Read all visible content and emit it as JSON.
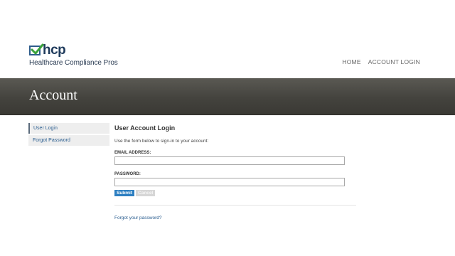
{
  "brand": {
    "logo_text": "hcp",
    "tagline": "Healthcare Compliance Pros"
  },
  "nav": {
    "items": [
      {
        "label": "HOME"
      },
      {
        "label": "ACCOUNT LOGIN"
      }
    ]
  },
  "banner": {
    "title": "Account"
  },
  "sidebar": {
    "items": [
      {
        "label": "User Login"
      },
      {
        "label": "Forgot Password"
      }
    ]
  },
  "login": {
    "title": "User Account Login",
    "intro": "Use the form below to sign-in to your account:",
    "email_label": "EMAIL ADDRESS:",
    "email_value": "",
    "password_label": "PASSWORD:",
    "password_value": "",
    "submit_label": "Submit",
    "cancel_label": "Cancel",
    "forgot_link": "Forgot your password?"
  },
  "colors": {
    "banner": "#44433e",
    "link": "#2a5d8f",
    "submit": "#2d7fc1",
    "logo_check": "#3aa33a"
  }
}
